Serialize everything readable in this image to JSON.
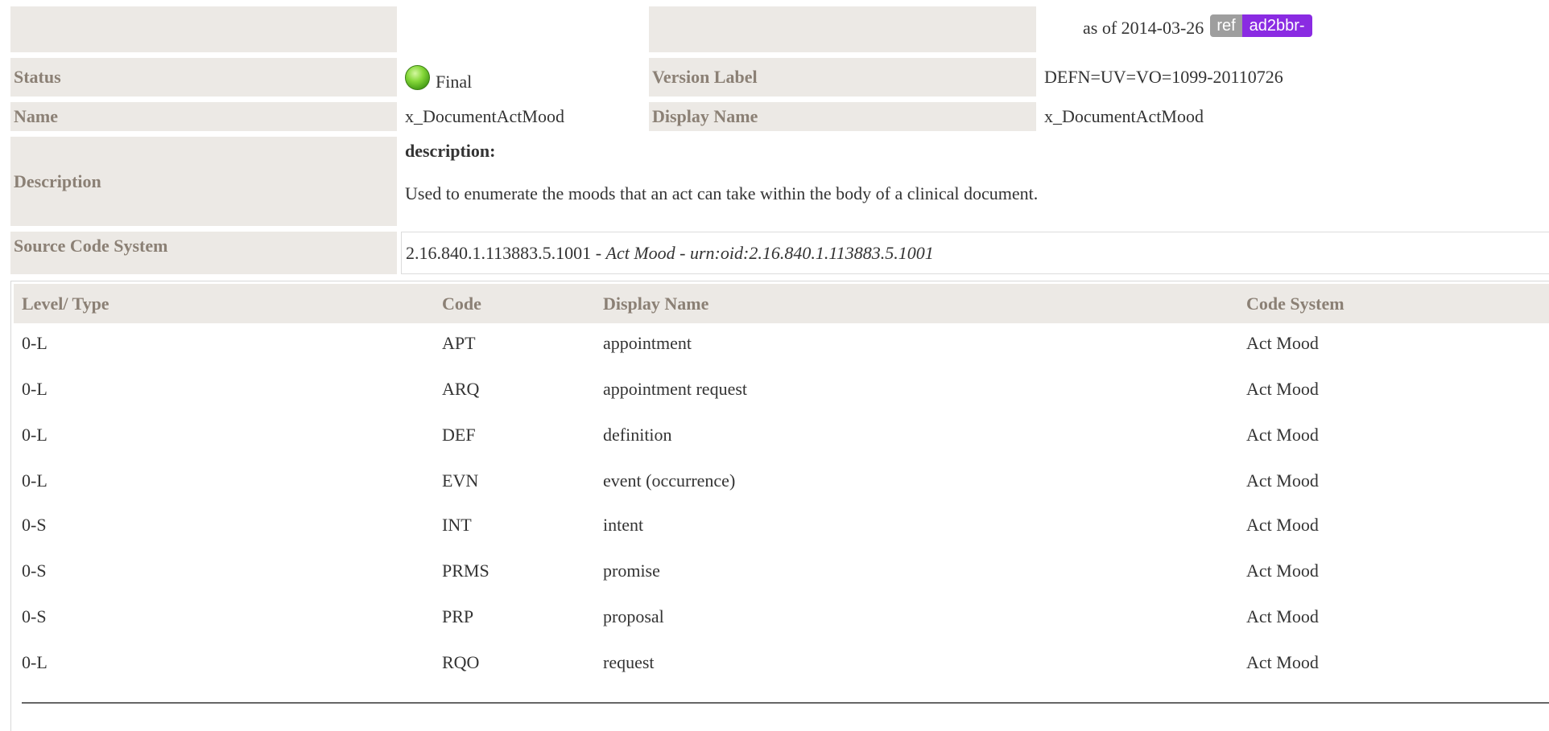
{
  "header": {
    "as_of_label": "as of 2014-03-26",
    "badge_left": "ref",
    "badge_right": "ad2bbr-"
  },
  "status": {
    "label": "Status",
    "value": "Final",
    "icon": "green-status-icon"
  },
  "version": {
    "label": "Version Label",
    "value": "DEFN=UV=VO=1099-20110726"
  },
  "name": {
    "label": "Name",
    "value": "x_DocumentActMood"
  },
  "display_name": {
    "label": "Display Name",
    "value": "x_DocumentActMood"
  },
  "description": {
    "label": "Description",
    "heading": "description:",
    "text": "Used to enumerate the moods that an act can take within the body of a clinical document."
  },
  "source_code_system": {
    "label": "Source Code System",
    "oid": "2.16.840.1.113883.5.1001",
    "sep1": " - ",
    "name": "Act Mood",
    "sep2": " - ",
    "urn": "urn:oid:2.16.840.1.113883.5.1001"
  },
  "table": {
    "headers": [
      "Level/ Type",
      "Code",
      "Display Name",
      "Code System"
    ],
    "rows": [
      [
        "0-L",
        "APT",
        "appointment",
        "Act Mood"
      ],
      [
        "0-L",
        "ARQ",
        "appointment request",
        "Act Mood"
      ],
      [
        "0-L",
        "DEF",
        "definition",
        "Act Mood"
      ],
      [
        "0-L",
        "EVN",
        "event (occurrence)",
        "Act Mood"
      ],
      [
        "0-S",
        "INT",
        "intent",
        "Act Mood"
      ],
      [
        "0-S",
        "PRMS",
        "promise",
        "Act Mood"
      ],
      [
        "0-S",
        "PRP",
        "proposal",
        "Act Mood"
      ],
      [
        "0-L",
        "RQO",
        "request",
        "Act Mood"
      ]
    ]
  },
  "colors": {
    "label_bg": "#ece9e5",
    "label_text": "#8b8075",
    "badge_gray": "#9e9e9e",
    "badge_purple": "#8a2be2",
    "status_green": "#6cc12a"
  }
}
